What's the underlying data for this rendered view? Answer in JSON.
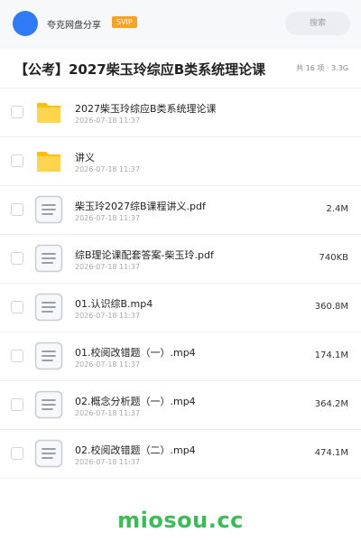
{
  "header": {
    "share_title": "夸克网盘分享",
    "badge": "SVIP",
    "search_label": "搜索"
  },
  "folder": {
    "title": "【公考】2027柴玉玲综应B类系统理论课",
    "summary": "共 16 项 · 3.3G"
  },
  "files": [
    {
      "name": "2027柴玉玲综应B类系统理论课",
      "date": "2026-07-18 11:37",
      "size": "",
      "icon": "folder-icon"
    },
    {
      "name": "讲义",
      "date": "2026-07-18 11:37",
      "size": "",
      "icon": "folder-icon"
    },
    {
      "name": "柴玉玲2027综B课程讲义.pdf",
      "date": "2026-07-18 11:37",
      "size": "2.4M",
      "icon": "document-icon"
    },
    {
      "name": "综B理论课配套答案-柴玉玲.pdf",
      "date": "2026-07-18 11:37",
      "size": "740KB",
      "icon": "document-icon"
    },
    {
      "name": "01.认识综B.mp4",
      "date": "2026-07-18 11:37",
      "size": "360.8M",
      "icon": "document-icon"
    },
    {
      "name": "01.校阅改错题（一）.mp4",
      "date": "2026-07-18 11:37",
      "size": "174.1M",
      "icon": "document-icon"
    },
    {
      "name": "02.概念分析题（一）.mp4",
      "date": "2026-07-18 11:37",
      "size": "364.2M",
      "icon": "document-icon"
    },
    {
      "name": "02.校阅改错题（二）.mp4",
      "date": "2026-07-18 11:37",
      "size": "474.1M",
      "icon": "document-icon"
    }
  ],
  "watermark": "miosou.cc",
  "colors": {
    "accent": "#2f7bf5",
    "badge": "#f7a325",
    "folder": "#ffc107",
    "watermark": "#3bbd55"
  }
}
